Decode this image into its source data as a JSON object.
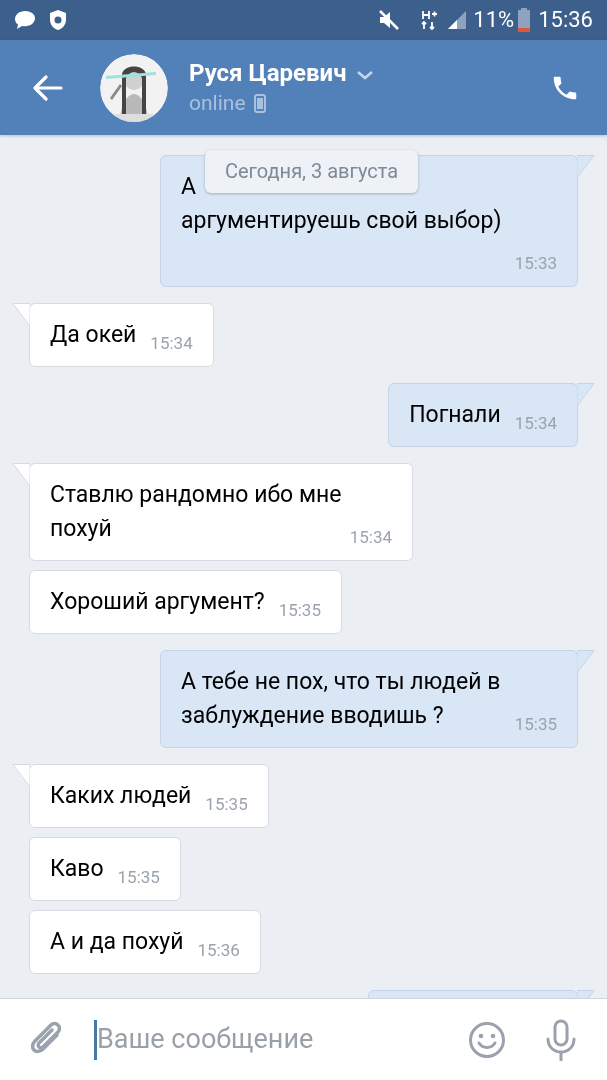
{
  "status_bar": {
    "battery": "11%",
    "time": "15:36"
  },
  "header": {
    "name": "Руся Царевич",
    "status": "online"
  },
  "date_chip": "Сегодня, 3 августа",
  "messages": [
    {
      "kind": "outgoing",
      "tail": true,
      "covered_start": "А",
      "text": "аргументируешь свой выбор)",
      "time": "15:33"
    },
    {
      "kind": "incoming",
      "tail": true,
      "text": "Да окей",
      "time": "15:34"
    },
    {
      "kind": "outgoing",
      "tail": true,
      "text": "Погнали",
      "time": "15:34"
    },
    {
      "kind": "incoming",
      "tail": true,
      "text": "Ставлю рандомно ибо мне похуй",
      "time": "15:34"
    },
    {
      "kind": "incoming",
      "tail": false,
      "text": "Хороший аргумент?",
      "time": "15:35"
    },
    {
      "kind": "outgoing",
      "tail": true,
      "text": "А тебе не пох, что ты людей в заблуждение вводишь ?",
      "time": "15:35"
    },
    {
      "kind": "incoming",
      "tail": true,
      "text": "Каких людей",
      "time": "15:35"
    },
    {
      "kind": "incoming",
      "tail": false,
      "text": "Каво",
      "time": "15:35"
    },
    {
      "kind": "incoming",
      "tail": false,
      "text": "А и да похуй",
      "time": "15:36"
    },
    {
      "kind": "outgoing",
      "tail": true,
      "cut": true
    }
  ],
  "composer": {
    "placeholder": "Ваше сообщение"
  }
}
